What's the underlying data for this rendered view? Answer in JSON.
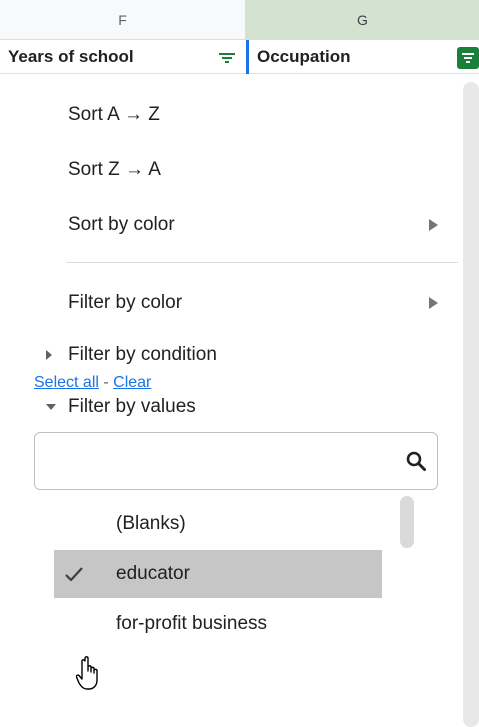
{
  "columns": {
    "f_letter": "F",
    "g_letter": "G"
  },
  "header_row": {
    "f_title": "Years of school",
    "g_title": "Occupation"
  },
  "menu": {
    "sort_az": "Sort A → Z",
    "sort_za": "Sort Z → A",
    "sort_by_color": "Sort by color",
    "filter_by_color": "Filter by color",
    "filter_by_condition": "Filter by condition",
    "filter_by_values": "Filter by values"
  },
  "links": {
    "select_all": "Select all",
    "separator": " - ",
    "clear": "Clear"
  },
  "search": {
    "placeholder": "",
    "value": ""
  },
  "values": [
    {
      "label": "(Blanks)",
      "checked": false
    },
    {
      "label": "educator",
      "checked": true
    },
    {
      "label": "for-profit business",
      "checked": false
    }
  ],
  "colors": {
    "accent_green": "#188038",
    "selection_blue": "#1a73e8",
    "selected_row": "#c6c6c6"
  }
}
